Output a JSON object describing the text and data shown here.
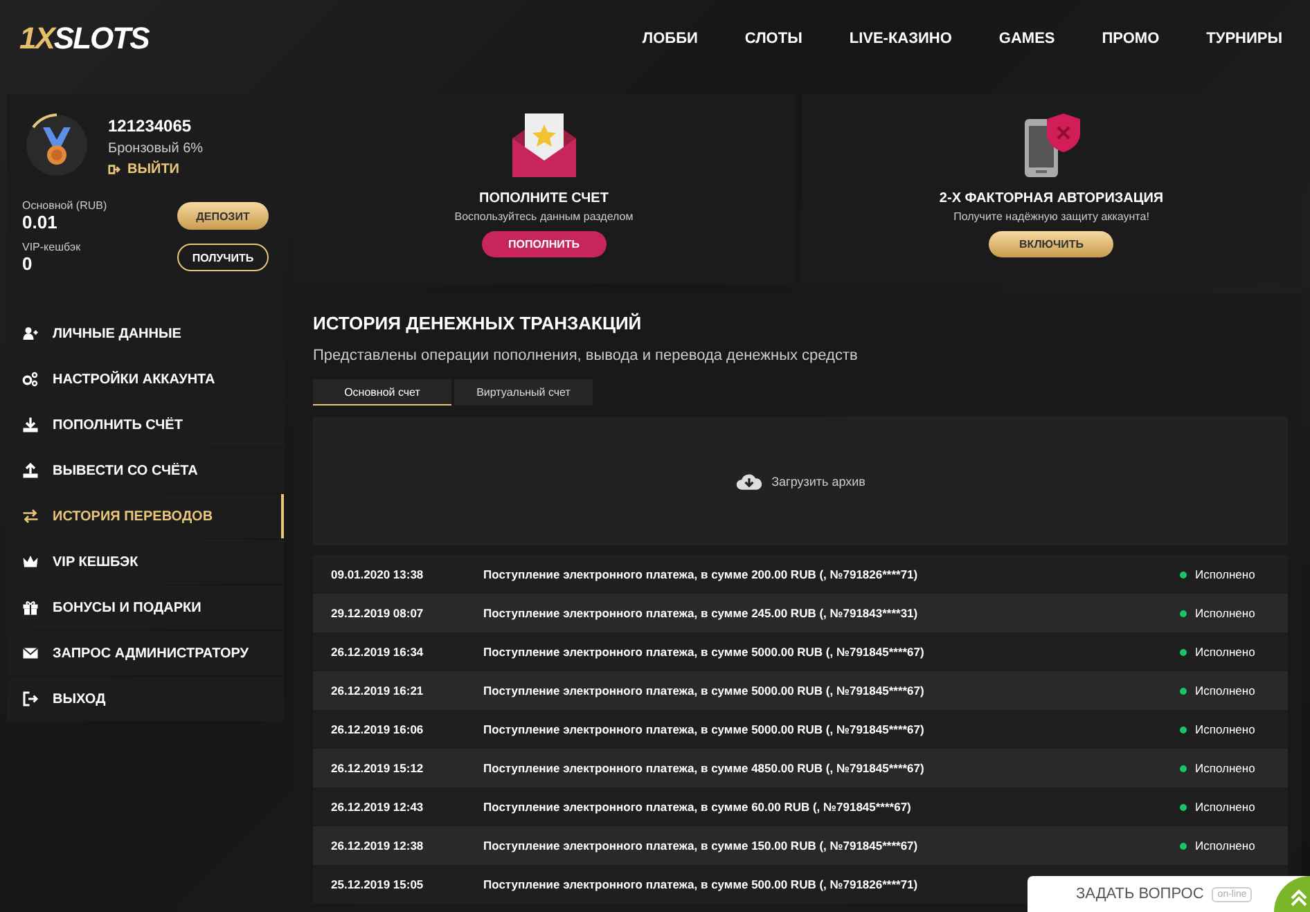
{
  "header": {
    "logo": {
      "accent": "1X",
      "text": "SLOTS"
    },
    "nav": [
      "ЛОББИ",
      "СЛОТЫ",
      "LIVE-КАЗИНО",
      "GAMES",
      "ПРОМО",
      "ТУРНИРЫ"
    ]
  },
  "profile": {
    "user_id": "121234065",
    "level": "Бронзовый 6%",
    "logout": "ВЫЙТИ",
    "balance_label": "Основной (RUB)",
    "balance": "0.01",
    "deposit_button": "ДЕПОЗИТ",
    "cashback_label": "VIP-кешбэк",
    "cashback": "0",
    "claim_button": "ПОЛУЧИТЬ"
  },
  "sidebar": {
    "items": [
      {
        "label": "ЛИЧНЫЕ ДАННЫЕ",
        "kind": "user",
        "selected": false
      },
      {
        "label": "НАСТРОЙКИ АККАУНТА",
        "kind": "gears",
        "selected": false
      },
      {
        "label": "ПОПОЛНИТЬ СЧЁТ",
        "kind": "download",
        "selected": false
      },
      {
        "label": "ВЫВЕСТИ СО СЧЁТА",
        "kind": "upload",
        "selected": false
      },
      {
        "label": "ИСТОРИЯ ПЕРЕВОДОВ",
        "kind": "arrows",
        "selected": true
      },
      {
        "label": "VIP КЕШБЭК",
        "kind": "crown",
        "selected": false
      },
      {
        "label": "БОНУСЫ И ПОДАРКИ",
        "kind": "gift",
        "selected": false
      },
      {
        "label": "ЗАПРОС АДМИНИСТРАТОРУ",
        "kind": "mail",
        "selected": false
      },
      {
        "label": "ВЫХОД",
        "kind": "exit",
        "selected": false
      }
    ]
  },
  "promo_cards": [
    {
      "kind": "envelope",
      "title": "ПОПОЛНИТЕ СЧЕТ",
      "text": "Воспользуйтесь данным разделом",
      "button": "ПОПОЛНИТЬ"
    },
    {
      "kind": "phone",
      "title": "2-Х ФАКТОРНАЯ АВТОРИЗАЦИЯ",
      "text": "Получите надёжную защиту аккаунта!",
      "button": "ВКЛЮЧИТЬ"
    }
  ],
  "history": {
    "title": "ИСТОРИЯ ДЕНЕЖНЫХ ТРАНЗАКЦИЙ",
    "subtitle": "Представлены операции пополнения, вывода и перевода денежных средств",
    "tabs": [
      {
        "label": "Основной счет",
        "selected": true
      },
      {
        "label": "Виртуальный счет",
        "selected": false
      }
    ],
    "archive_button": "Загрузить архив",
    "rows": [
      {
        "date": "09.01.2020 13:38",
        "description": "Поступление электронного платежа, в сумме 200.00 RUB (, №791826****71)",
        "status": "Исполнено"
      },
      {
        "date": "29.12.2019 08:07",
        "description": "Поступление электронного платежа, в сумме 245.00 RUB (, №791843****31)",
        "status": "Исполнено"
      },
      {
        "date": "26.12.2019 16:34",
        "description": "Поступление электронного платежа, в сумме 5000.00 RUB (, №791845****67)",
        "status": "Исполнено"
      },
      {
        "date": "26.12.2019 16:21",
        "description": "Поступление электронного платежа, в сумме 5000.00 RUB (, №791845****67)",
        "status": "Исполнено"
      },
      {
        "date": "26.12.2019 16:06",
        "description": "Поступление электронного платежа, в сумме 5000.00 RUB (, №791845****67)",
        "status": "Исполнено"
      },
      {
        "date": "26.12.2019 15:12",
        "description": "Поступление электронного платежа, в сумме 4850.00 RUB (, №791845****67)",
        "status": "Исполнено"
      },
      {
        "date": "26.12.2019 12:43",
        "description": "Поступление электронного платежа, в сумме 60.00 RUB (, №791845****67)",
        "status": "Исполнено"
      },
      {
        "date": "26.12.2019 12:38",
        "description": "Поступление электронного платежа, в сумме 150.00 RUB (, №791845****67)",
        "status": "Исполнено"
      },
      {
        "date": "25.12.2019 15:05",
        "description": "Поступление электронного платежа, в сумме 500.00 RUB (, №791826****71)"
      }
    ]
  },
  "chat": {
    "label": "ЗАДАТЬ ВОПРОС",
    "badge": "on-line"
  }
}
